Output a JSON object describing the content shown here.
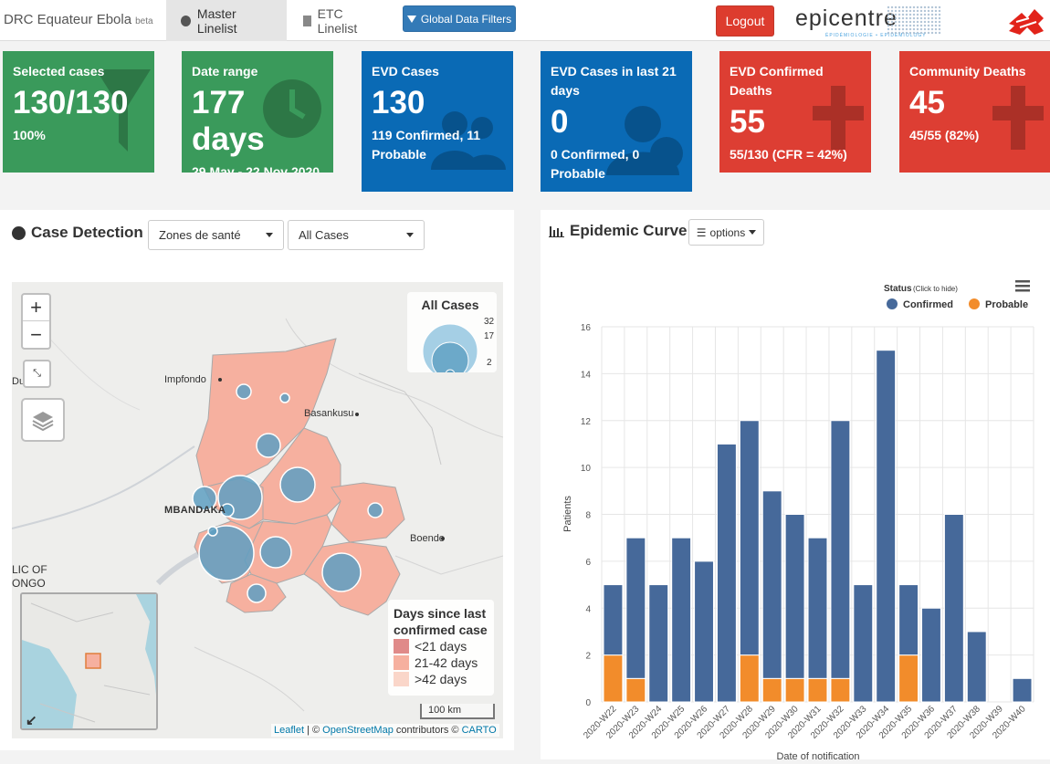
{
  "app": {
    "title": "DRC Equateur Ebola",
    "badge": "beta"
  },
  "nav": {
    "tabs": [
      {
        "label": "Master Linelist"
      },
      {
        "label": "ETC Linelist"
      }
    ],
    "filter_button": "Global Data Filters",
    "logout": "Logout"
  },
  "logos": {
    "epicentre": "epicentre",
    "epicentre_tagline": "ÉPIDÉMIOLOGIE • EPIDEMIOLOGY"
  },
  "value_boxes": [
    {
      "label": "Selected cases",
      "value": "130/130",
      "sub": "100%",
      "color": "#3a9a5b",
      "icon": "filter-icon"
    },
    {
      "label": "Date range",
      "value": "177 days",
      "sub": "29 May - 22 Nov 2020",
      "color": "#3a9a5b",
      "icon": "clock-icon"
    },
    {
      "label": "EVD Cases",
      "value": "130",
      "sub": "119 Confirmed, 11 Probable",
      "color": "#0a6ab5",
      "icon": "users-icon"
    },
    {
      "label": "EVD Cases in last 21 days",
      "value": "0",
      "sub": "0 Confirmed, 0 Probable",
      "color": "#0a6ab5",
      "icon": "user-clock-icon"
    },
    {
      "label": "EVD Confirmed Deaths",
      "value": "55",
      "sub": "55/130 (CFR = 42%)",
      "color": "#dd3e33",
      "icon": "cross-icon"
    },
    {
      "label": "Community Deaths",
      "value": "45",
      "sub": "45/55 (82%)",
      "color": "#dd3e33",
      "icon": "cross-icon"
    }
  ],
  "case_detection": {
    "title": "Case Detection",
    "zone_select": "Zones de santé",
    "case_select": "All Cases",
    "size_legend": {
      "title": "All Cases",
      "values": [
        "32",
        "17",
        "2"
      ]
    },
    "color_legend": {
      "title": "Days since last confirmed case",
      "items": [
        {
          "label": "<21 days",
          "color": "#e08a89"
        },
        {
          "label": "21-42 days",
          "color": "#f6b09f"
        },
        {
          "label": ">42 days",
          "color": "#fad6c9"
        }
      ]
    },
    "places": [
      "Impfondo",
      "Basankusu",
      "MBANDAKA",
      "Boende",
      "LIC OF",
      "ONGO",
      "Du"
    ],
    "scale": "100 km",
    "attribution": {
      "leaflet": "Leaflet",
      "sep": " | © ",
      "osm": "OpenStreetMap",
      "contrib": " contributors © ",
      "carto": "CARTO"
    },
    "zoom_in": "+",
    "zoom_out": "−"
  },
  "epi_curve": {
    "title": "Epidemic Curve",
    "options_label": "options"
  },
  "chart_data": {
    "type": "bar",
    "stacked": true,
    "legend_title": "Status",
    "legend_hint": "(Click to hide)",
    "legend_position": "top-right",
    "xlabel": "Date of notification",
    "ylabel": "Patients",
    "ylim": [
      0,
      16
    ],
    "yticks": [
      0,
      2,
      4,
      6,
      8,
      10,
      12,
      14,
      16
    ],
    "categories": [
      "2020-W22",
      "2020-W23",
      "2020-W24",
      "2020-W25",
      "2020-W26",
      "2020-W27",
      "2020-W28",
      "2020-W29",
      "2020-W30",
      "2020-W31",
      "2020-W32",
      "2020-W33",
      "2020-W34",
      "2020-W35",
      "2020-W36",
      "2020-W37",
      "2020-W38",
      "2020-W39",
      "2020-W40"
    ],
    "series": [
      {
        "name": "Confirmed",
        "color": "#46699a",
        "values": [
          3,
          6,
          5,
          7,
          6,
          11,
          10,
          8,
          7,
          6,
          11,
          5,
          15,
          3,
          4,
          8,
          3,
          0,
          1
        ]
      },
      {
        "name": "Probable",
        "color": "#f28c2b",
        "values": [
          2,
          1,
          0,
          0,
          0,
          0,
          2,
          1,
          1,
          1,
          1,
          0,
          0,
          2,
          0,
          0,
          0,
          0,
          0
        ]
      }
    ],
    "grid": true
  }
}
